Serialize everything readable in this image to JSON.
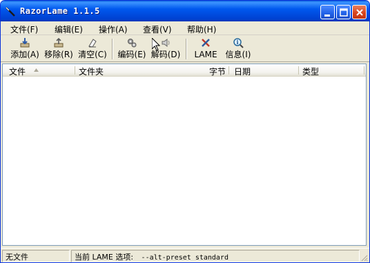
{
  "window": {
    "title": "RazorLame 1.1.5",
    "accent": "#0054e3",
    "close_color": "#d8421b"
  },
  "menu": [
    {
      "label": "文件(F)"
    },
    {
      "label": "编辑(E)"
    },
    {
      "label": "操作(A)"
    },
    {
      "label": "查看(V)"
    },
    {
      "label": "帮助(H)"
    }
  ],
  "toolbar": {
    "buttons": [
      {
        "label": "添加(A)",
        "icon": "add-icon"
      },
      {
        "label": "移除(R)",
        "icon": "remove-icon"
      },
      {
        "label": "清空(C)",
        "icon": "clear-icon"
      },
      {
        "label": "编码(E)",
        "icon": "encode-gears-icon"
      },
      {
        "label": "解码(D)",
        "icon": "decode-speaker-icon"
      },
      {
        "label": "LAME",
        "icon": "lame-tools-icon"
      },
      {
        "label": "信息(I)",
        "icon": "info-magnifier-icon"
      }
    ]
  },
  "list": {
    "columns": [
      {
        "label": "文件"
      },
      {
        "label": "文件夹"
      },
      {
        "label": "字节"
      },
      {
        "label": "日期"
      },
      {
        "label": "类型"
      }
    ],
    "rows": []
  },
  "status": {
    "files": "无文件",
    "options_label": "当前 LAME 选项:",
    "options_value": "--alt-preset standard"
  }
}
